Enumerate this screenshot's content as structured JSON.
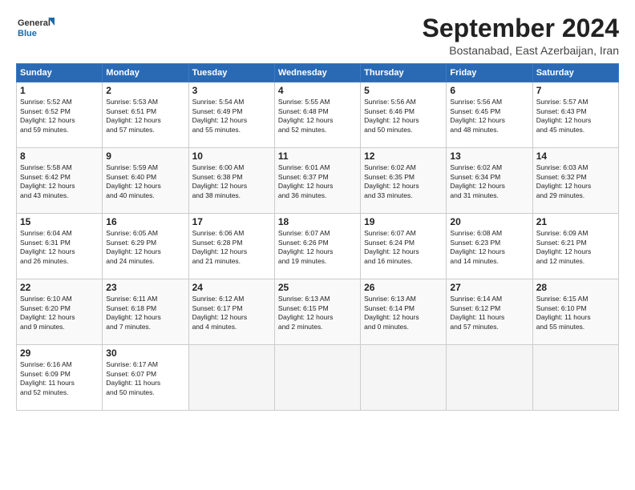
{
  "logo": {
    "line1": "General",
    "line2": "Blue"
  },
  "title": "September 2024",
  "subtitle": "Bostanabad, East Azerbaijan, Iran",
  "headers": [
    "Sunday",
    "Monday",
    "Tuesday",
    "Wednesday",
    "Thursday",
    "Friday",
    "Saturday"
  ],
  "weeks": [
    [
      {
        "num": "1",
        "info": "Sunrise: 5:52 AM\nSunset: 6:52 PM\nDaylight: 12 hours\nand 59 minutes."
      },
      {
        "num": "2",
        "info": "Sunrise: 5:53 AM\nSunset: 6:51 PM\nDaylight: 12 hours\nand 57 minutes."
      },
      {
        "num": "3",
        "info": "Sunrise: 5:54 AM\nSunset: 6:49 PM\nDaylight: 12 hours\nand 55 minutes."
      },
      {
        "num": "4",
        "info": "Sunrise: 5:55 AM\nSunset: 6:48 PM\nDaylight: 12 hours\nand 52 minutes."
      },
      {
        "num": "5",
        "info": "Sunrise: 5:56 AM\nSunset: 6:46 PM\nDaylight: 12 hours\nand 50 minutes."
      },
      {
        "num": "6",
        "info": "Sunrise: 5:56 AM\nSunset: 6:45 PM\nDaylight: 12 hours\nand 48 minutes."
      },
      {
        "num": "7",
        "info": "Sunrise: 5:57 AM\nSunset: 6:43 PM\nDaylight: 12 hours\nand 45 minutes."
      }
    ],
    [
      {
        "num": "8",
        "info": "Sunrise: 5:58 AM\nSunset: 6:42 PM\nDaylight: 12 hours\nand 43 minutes."
      },
      {
        "num": "9",
        "info": "Sunrise: 5:59 AM\nSunset: 6:40 PM\nDaylight: 12 hours\nand 40 minutes."
      },
      {
        "num": "10",
        "info": "Sunrise: 6:00 AM\nSunset: 6:38 PM\nDaylight: 12 hours\nand 38 minutes."
      },
      {
        "num": "11",
        "info": "Sunrise: 6:01 AM\nSunset: 6:37 PM\nDaylight: 12 hours\nand 36 minutes."
      },
      {
        "num": "12",
        "info": "Sunrise: 6:02 AM\nSunset: 6:35 PM\nDaylight: 12 hours\nand 33 minutes."
      },
      {
        "num": "13",
        "info": "Sunrise: 6:02 AM\nSunset: 6:34 PM\nDaylight: 12 hours\nand 31 minutes."
      },
      {
        "num": "14",
        "info": "Sunrise: 6:03 AM\nSunset: 6:32 PM\nDaylight: 12 hours\nand 29 minutes."
      }
    ],
    [
      {
        "num": "15",
        "info": "Sunrise: 6:04 AM\nSunset: 6:31 PM\nDaylight: 12 hours\nand 26 minutes."
      },
      {
        "num": "16",
        "info": "Sunrise: 6:05 AM\nSunset: 6:29 PM\nDaylight: 12 hours\nand 24 minutes."
      },
      {
        "num": "17",
        "info": "Sunrise: 6:06 AM\nSunset: 6:28 PM\nDaylight: 12 hours\nand 21 minutes."
      },
      {
        "num": "18",
        "info": "Sunrise: 6:07 AM\nSunset: 6:26 PM\nDaylight: 12 hours\nand 19 minutes."
      },
      {
        "num": "19",
        "info": "Sunrise: 6:07 AM\nSunset: 6:24 PM\nDaylight: 12 hours\nand 16 minutes."
      },
      {
        "num": "20",
        "info": "Sunrise: 6:08 AM\nSunset: 6:23 PM\nDaylight: 12 hours\nand 14 minutes."
      },
      {
        "num": "21",
        "info": "Sunrise: 6:09 AM\nSunset: 6:21 PM\nDaylight: 12 hours\nand 12 minutes."
      }
    ],
    [
      {
        "num": "22",
        "info": "Sunrise: 6:10 AM\nSunset: 6:20 PM\nDaylight: 12 hours\nand 9 minutes."
      },
      {
        "num": "23",
        "info": "Sunrise: 6:11 AM\nSunset: 6:18 PM\nDaylight: 12 hours\nand 7 minutes."
      },
      {
        "num": "24",
        "info": "Sunrise: 6:12 AM\nSunset: 6:17 PM\nDaylight: 12 hours\nand 4 minutes."
      },
      {
        "num": "25",
        "info": "Sunrise: 6:13 AM\nSunset: 6:15 PM\nDaylight: 12 hours\nand 2 minutes."
      },
      {
        "num": "26",
        "info": "Sunrise: 6:13 AM\nSunset: 6:14 PM\nDaylight: 12 hours\nand 0 minutes."
      },
      {
        "num": "27",
        "info": "Sunrise: 6:14 AM\nSunset: 6:12 PM\nDaylight: 11 hours\nand 57 minutes."
      },
      {
        "num": "28",
        "info": "Sunrise: 6:15 AM\nSunset: 6:10 PM\nDaylight: 11 hours\nand 55 minutes."
      }
    ],
    [
      {
        "num": "29",
        "info": "Sunrise: 6:16 AM\nSunset: 6:09 PM\nDaylight: 11 hours\nand 52 minutes."
      },
      {
        "num": "30",
        "info": "Sunrise: 6:17 AM\nSunset: 6:07 PM\nDaylight: 11 hours\nand 50 minutes."
      },
      {
        "num": "",
        "info": ""
      },
      {
        "num": "",
        "info": ""
      },
      {
        "num": "",
        "info": ""
      },
      {
        "num": "",
        "info": ""
      },
      {
        "num": "",
        "info": ""
      }
    ]
  ]
}
